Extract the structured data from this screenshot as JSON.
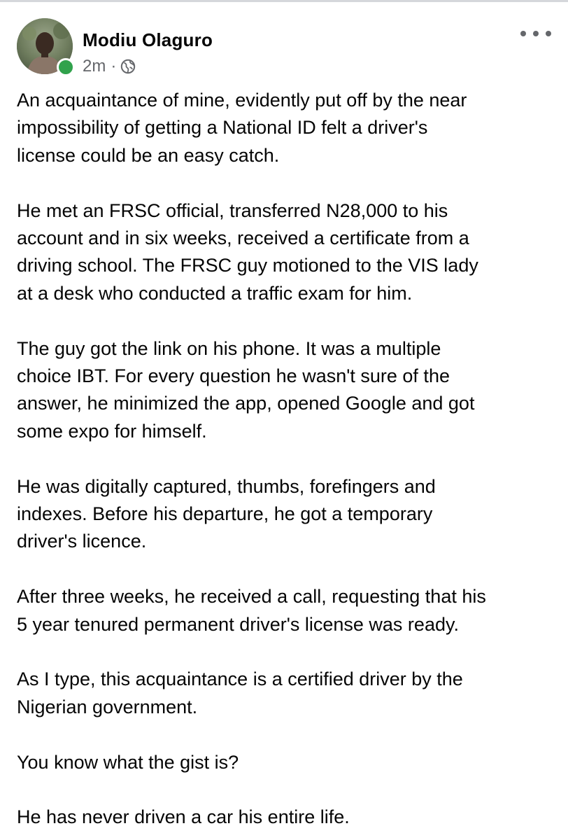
{
  "post": {
    "author": {
      "name": "Modiu Olaguro",
      "online": true,
      "avatar_icon": "profile-photo"
    },
    "timestamp": "2m",
    "separator": "·",
    "privacy_icon": "globe-icon",
    "more_icon": "more-options-icon",
    "paragraphs": [
      {
        "lines": [
          "An acquaintance of mine, evidently put off by the near",
          "impossibility of getting a National ID felt a driver's",
          "license could be an easy catch."
        ]
      },
      {
        "lines": [
          "He met an FRSC official, transferred N28,000 to his",
          "account and in six weeks, received a certificate from a",
          "driving school. The FRSC guy motioned to the VIS lady",
          "at a desk who conducted a traffic exam for him."
        ]
      },
      {
        "lines": [
          "The guy got the link on his phone. It was a multiple",
          "choice IBT. For every question he wasn't sure of the",
          "answer, he minimized the app, opened Google and got",
          "some expo for himself."
        ]
      },
      {
        "lines": [
          "He was digitally captured, thumbs, forefingers and",
          "indexes. Before his departure, he got a temporary",
          "driver's licence."
        ]
      },
      {
        "lines": [
          "After three weeks, he received a call, requesting that his",
          "5 year tenured permanent driver's license was ready."
        ]
      },
      {
        "lines": [
          "As I type, this acquaintance is a certified driver by the",
          "Nigerian government."
        ]
      },
      {
        "lines": [
          "You know what the gist is?"
        ]
      },
      {
        "lines": [
          "He has never driven a car his entire life."
        ]
      }
    ]
  },
  "colors": {
    "online_indicator": "#31a24c",
    "secondary_text": "#65676b",
    "primary_text": "#050505",
    "top_border": "#d5d7db"
  }
}
